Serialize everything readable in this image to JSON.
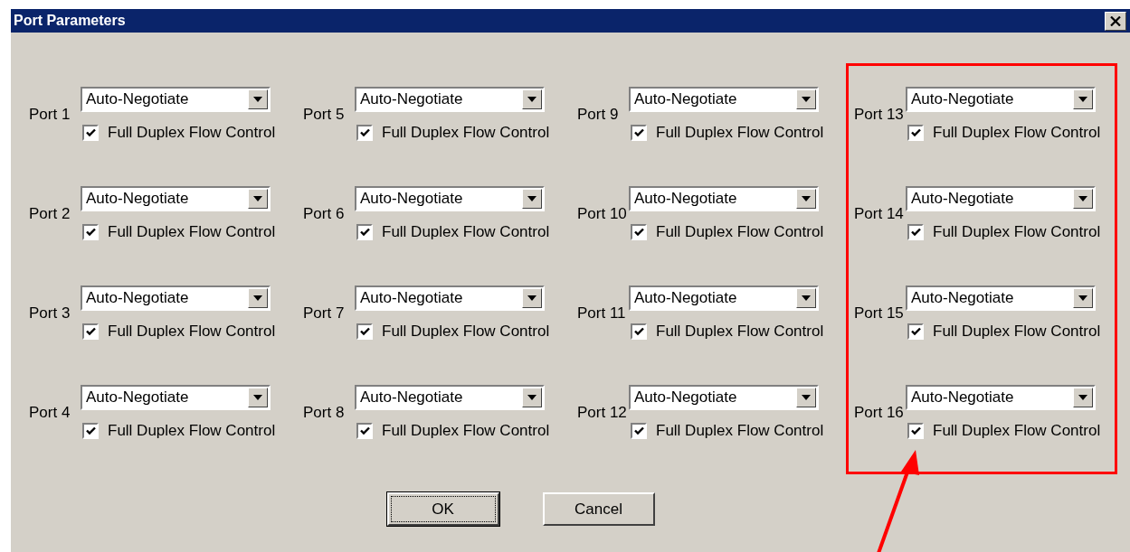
{
  "window": {
    "title": "Port Parameters"
  },
  "columns": [
    {
      "highlighted": false,
      "ports": [
        {
          "label": "Port 1",
          "speed": "Auto-Negotiate",
          "option": "Full Duplex Flow Control",
          "checked": true
        },
        {
          "label": "Port 2",
          "speed": "Auto-Negotiate",
          "option": "Full Duplex Flow Control",
          "checked": true
        },
        {
          "label": "Port 3",
          "speed": "Auto-Negotiate",
          "option": "Full Duplex Flow Control",
          "checked": true
        },
        {
          "label": "Port 4",
          "speed": "Auto-Negotiate",
          "option": "Full Duplex Flow Control",
          "checked": true
        }
      ]
    },
    {
      "highlighted": false,
      "ports": [
        {
          "label": "Port 5",
          "speed": "Auto-Negotiate",
          "option": "Full Duplex Flow Control",
          "checked": true
        },
        {
          "label": "Port 6",
          "speed": "Auto-Negotiate",
          "option": "Full Duplex Flow Control",
          "checked": true
        },
        {
          "label": "Port 7",
          "speed": "Auto-Negotiate",
          "option": "Full Duplex Flow Control",
          "checked": true
        },
        {
          "label": "Port 8",
          "speed": "Auto-Negotiate",
          "option": "Full Duplex Flow Control",
          "checked": true
        }
      ]
    },
    {
      "highlighted": false,
      "ports": [
        {
          "label": "Port 9",
          "speed": "Auto-Negotiate",
          "option": "Full Duplex Flow Control",
          "checked": true
        },
        {
          "label": "Port 10",
          "speed": "Auto-Negotiate",
          "option": "Full Duplex Flow Control",
          "checked": true
        },
        {
          "label": "Port 11",
          "speed": "Auto-Negotiate",
          "option": "Full Duplex Flow Control",
          "checked": true
        },
        {
          "label": "Port 12",
          "speed": "Auto-Negotiate",
          "option": "Full Duplex Flow Control",
          "checked": true
        }
      ]
    },
    {
      "highlighted": true,
      "ports": [
        {
          "label": "Port 13",
          "speed": "Auto-Negotiate",
          "option": "Full Duplex Flow Control",
          "checked": true
        },
        {
          "label": "Port 14",
          "speed": "Auto-Negotiate",
          "option": "Full Duplex Flow Control",
          "checked": true
        },
        {
          "label": "Port 15",
          "speed": "Auto-Negotiate",
          "option": "Full Duplex Flow Control",
          "checked": true
        },
        {
          "label": "Port 16",
          "speed": "Auto-Negotiate",
          "option": "Full Duplex Flow Control",
          "checked": true
        }
      ]
    }
  ],
  "buttons": [
    {
      "label": "OK",
      "default": true
    },
    {
      "label": "Cancel",
      "default": false
    }
  ]
}
